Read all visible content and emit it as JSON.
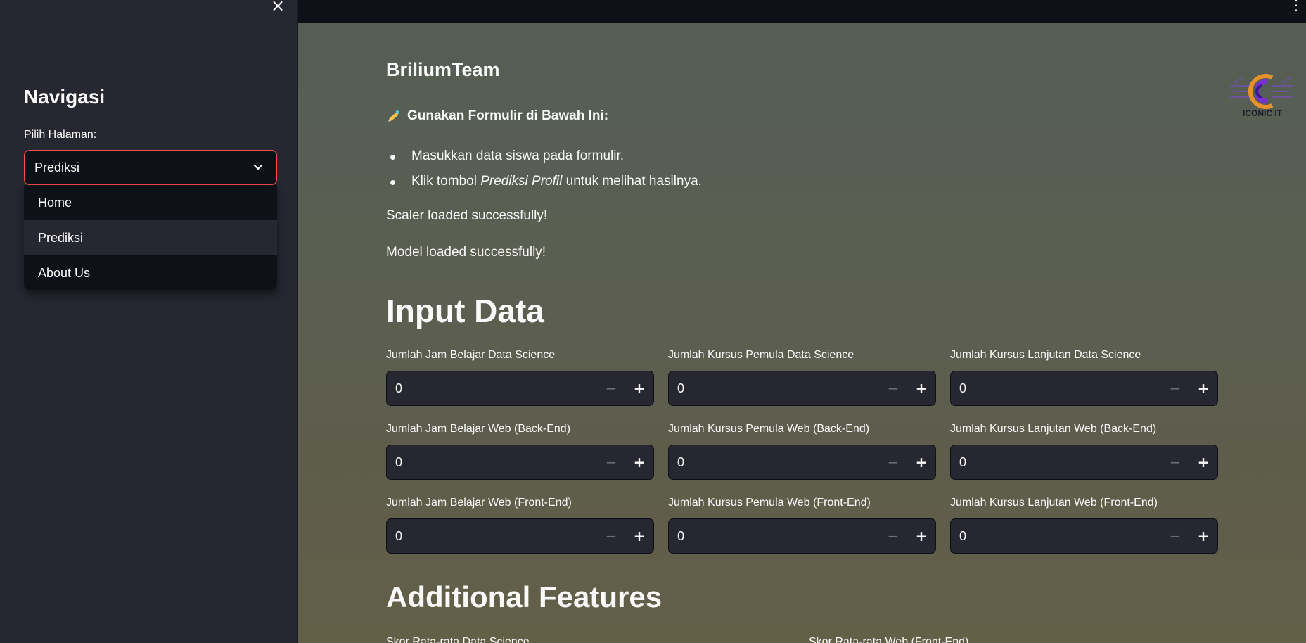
{
  "sidebar": {
    "title": "Navigasi",
    "select_label": "Pilih Halaman:",
    "selected": "Prediksi",
    "options": [
      "Home",
      "Prediksi",
      "About Us"
    ]
  },
  "header": {
    "brand": "BriliumTeam",
    "logo_text": "ICONIC IT"
  },
  "intro": {
    "subhead": "Gunakan Formulir di Bawah Ini:",
    "bullet1": "Masukkan data siswa pada formulir.",
    "bullet2_pre": "Klik tombol ",
    "bullet2_em": "Prediksi Profil",
    "bullet2_post": " untuk melihat hasilnya.",
    "status1": "Scaler loaded successfully!",
    "status2": "Model loaded successfully!"
  },
  "input_section": {
    "title": "Input Data",
    "fields": [
      {
        "label": "Jumlah Jam Belajar Data Science",
        "value": "0"
      },
      {
        "label": "Jumlah Kursus Pemula Data Science",
        "value": "0"
      },
      {
        "label": "Jumlah Kursus Lanjutan Data Science",
        "value": "0"
      },
      {
        "label": "Jumlah Jam Belajar Web (Back-End)",
        "value": "0"
      },
      {
        "label": "Jumlah Kursus Pemula Web (Back-End)",
        "value": "0"
      },
      {
        "label": "Jumlah Kursus Lanjutan Web (Back-End)",
        "value": "0"
      },
      {
        "label": "Jumlah Jam Belajar Web (Front-End)",
        "value": "0"
      },
      {
        "label": "Jumlah Kursus Pemula Web (Front-End)",
        "value": "0"
      },
      {
        "label": "Jumlah Kursus Lanjutan Web (Front-End)",
        "value": "0"
      }
    ]
  },
  "additional_section": {
    "title": "Additional Features",
    "label1": "Skor Rata-rata Data Science",
    "label2": "Skor Rata-rata Web (Front-End)"
  },
  "icons": {
    "close": "close-icon",
    "chevron": "chevron-down-icon",
    "menu": "kebab-menu-icon",
    "pencil": "pencil-icon"
  },
  "colors": {
    "accent": "#ff4b4b",
    "sidebar_bg": "#262730",
    "app_bg": "#0e1117",
    "input_bg": "#262730"
  }
}
